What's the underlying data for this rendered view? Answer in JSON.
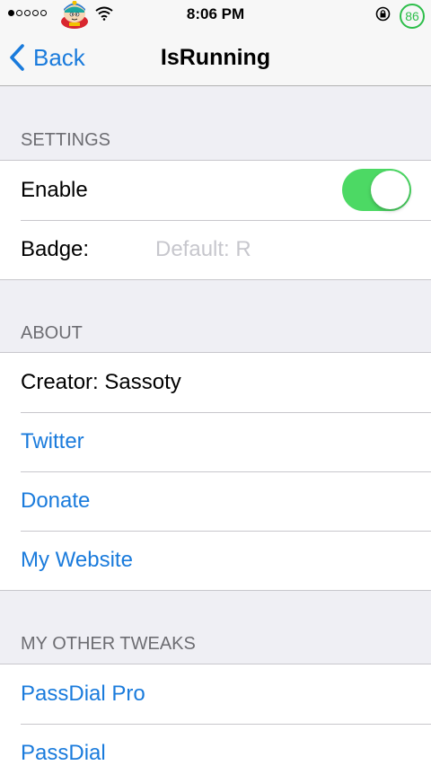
{
  "status_bar": {
    "signal_bars_filled": 1,
    "signal_bars_total": 5,
    "carrier_icon": "cartman-avatar-icon",
    "wifi_icon": "wifi-icon",
    "time": "8:06 PM",
    "rotation_lock_icon": "rotation-lock-icon",
    "battery": "86",
    "battery_color": "#2dbe4a"
  },
  "nav": {
    "back_label": "Back",
    "back_icon": "chevron-left-icon",
    "title": "IsRunning"
  },
  "colors": {
    "link": "#1a7bdc",
    "toggle_on": "#4cd964",
    "background": "#efeff4"
  },
  "settings": {
    "header": "SETTINGS",
    "enable_label": "Enable",
    "enable_on": true,
    "badge_label": "Badge:",
    "badge_value": "",
    "badge_placeholder": "Default: R"
  },
  "about": {
    "header": "ABOUT",
    "creator": "Creator: Sassoty",
    "links": [
      "Twitter",
      "Donate",
      "My Website"
    ]
  },
  "other_tweaks": {
    "header": "MY OTHER TWEAKS",
    "items": [
      "PassDial Pro",
      "PassDial"
    ]
  }
}
